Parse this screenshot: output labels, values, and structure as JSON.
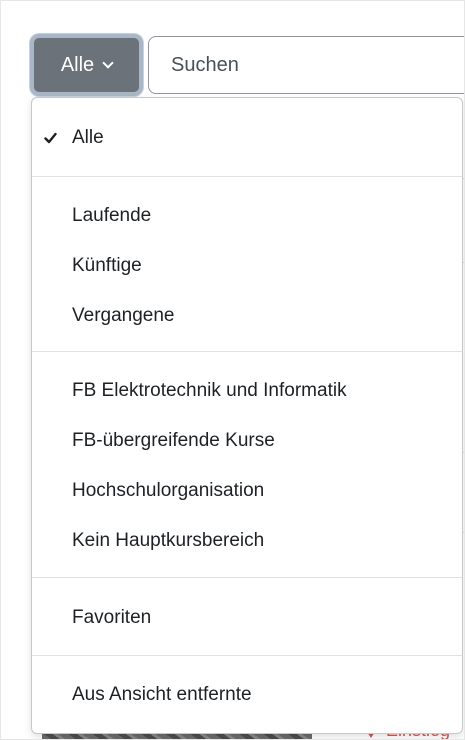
{
  "filter_toggle": {
    "label": "Alle",
    "icon": "chevron-down-icon"
  },
  "search": {
    "placeholder": "Suchen",
    "value": ""
  },
  "menu": {
    "items": [
      {
        "label": "Alle",
        "selected": true
      },
      {
        "label": "Laufende"
      },
      {
        "label": "Künftige"
      },
      {
        "label": "Vergangene"
      },
      {
        "label": "FB Elektrotechnik und Informatik"
      },
      {
        "label": "FB-übergreifende Kurse"
      },
      {
        "label": "Hochschulorganisation"
      },
      {
        "label": "Kein Hauptkursbereich"
      },
      {
        "label": "Favoriten"
      },
      {
        "label": "Aus Ansicht entfernte"
      }
    ]
  },
  "background": {
    "link_partial": "Einstieg"
  },
  "colors": {
    "toggle_bg": "#6b7279",
    "toggle_focus": "#a8b6c6",
    "accent_red": "#d9534f",
    "text": "#1d2125"
  }
}
